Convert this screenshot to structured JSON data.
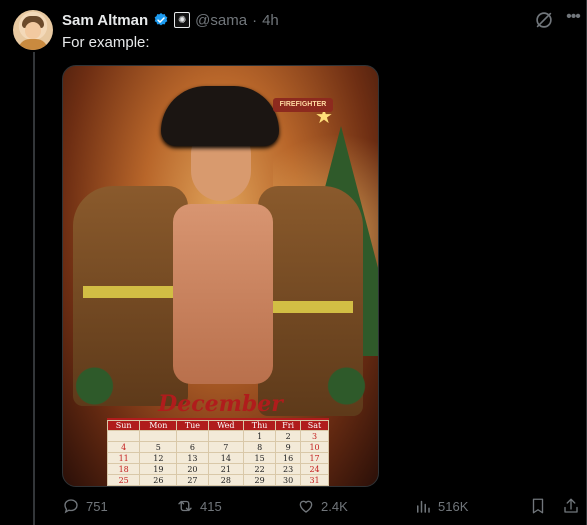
{
  "post": {
    "author_name": "Sam Altman",
    "handle": "@sama",
    "separator": "·",
    "time": "4h",
    "affiliate_badge_icon": "openai-logo-icon",
    "verified_icon": "verified-badge-icon",
    "text": "For example:"
  },
  "media": {
    "calendar_month": "December",
    "helmet_text": "FIREFIGHTER",
    "weekdays": [
      "Sun",
      "Mon",
      "Tue",
      "Wed",
      "Thu",
      "Fri",
      "Sat"
    ],
    "weeks": [
      [
        "",
        "",
        "",
        "",
        "1",
        "2",
        "3"
      ],
      [
        "4",
        "5",
        "6",
        "7",
        "8",
        "9",
        "10"
      ],
      [
        "11",
        "12",
        "13",
        "14",
        "15",
        "16",
        "17"
      ],
      [
        "18",
        "19",
        "20",
        "21",
        "22",
        "23",
        "24"
      ],
      [
        "25",
        "26",
        "27",
        "28",
        "29",
        "30",
        "31"
      ]
    ]
  },
  "actions": {
    "replies": "751",
    "reposts": "415",
    "likes": "2.4K",
    "views": "516K"
  },
  "colors": {
    "background": "#000000",
    "text_primary": "#e7e9ea",
    "text_secondary": "#71767b",
    "verified_blue": "#1d9bf0",
    "calendar_red": "#b01c1c"
  }
}
